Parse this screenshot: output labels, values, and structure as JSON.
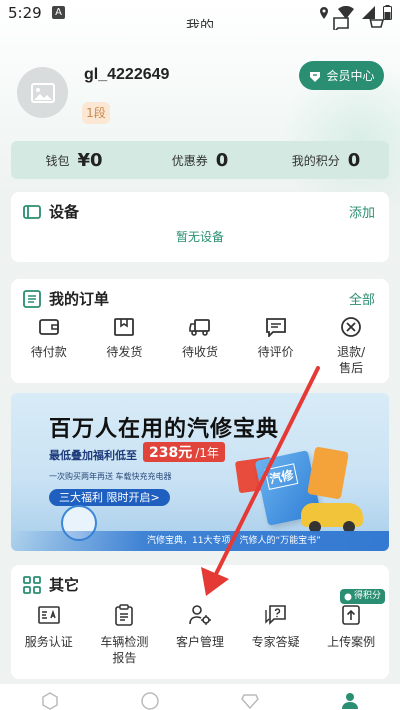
{
  "status_bar": {
    "time": "5:29",
    "a_badge": "A"
  },
  "page_title": "我的",
  "profile": {
    "username": "gl_4222649",
    "level": "1段",
    "member_button": "会员中心"
  },
  "stats": [
    {
      "label": "钱包",
      "value": "¥0"
    },
    {
      "label": "优惠券",
      "value": "0"
    },
    {
      "label": "我的积分",
      "value": "0"
    }
  ],
  "devices": {
    "title": "设备",
    "link": "添加",
    "empty": "暂无设备"
  },
  "orders": {
    "title": "我的订单",
    "link": "全部",
    "items": [
      {
        "label": "待付款",
        "icon": "wallet-icon"
      },
      {
        "label": "待发货",
        "icon": "package-icon"
      },
      {
        "label": "待收货",
        "icon": "truck-icon"
      },
      {
        "label": "待评价",
        "icon": "comment-icon"
      },
      {
        "label": "退款/售后",
        "icon": "refund-icon"
      }
    ]
  },
  "banner": {
    "title": "百万人在用的汽修宝典",
    "subtitle": "最低叠加福利低至",
    "price_amount": "238元",
    "price_unit": "/1年",
    "line1": "一次购买两年再送  车载快充充电器",
    "line2": "三大福利  限时开启>",
    "footer": "汽修宝典，11大专项，汽修人的“万能宝书”",
    "book_text": "汽修"
  },
  "others": {
    "title": "其它",
    "badge": "得积分",
    "items": [
      {
        "label": "服务认证",
        "icon": "certificate-icon"
      },
      {
        "label": "车辆检测报告",
        "icon": "report-icon"
      },
      {
        "label": "客户管理",
        "icon": "customer-settings-icon"
      },
      {
        "label": "专家答疑",
        "icon": "question-icon"
      },
      {
        "label": "上传案例",
        "icon": "upload-icon"
      }
    ]
  },
  "bottom_nav": [
    {
      "icon": "box-icon"
    },
    {
      "icon": "ai-icon"
    },
    {
      "icon": "diamond-icon"
    },
    {
      "icon": "person-icon"
    }
  ],
  "colors": {
    "accent": "#2a8e72",
    "arrow": "#e53935"
  }
}
